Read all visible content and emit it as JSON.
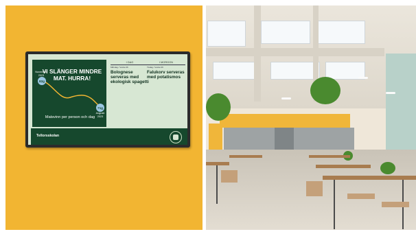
{
  "tv_screen": {
    "headline": "VI SLÄNGER MINDRE MAT. HURRA!",
    "start_month": "November",
    "start_year": "2023",
    "start_value": "82g",
    "end_value": "71g",
    "end_month": "Augusti",
    "end_year": "2023",
    "caption": "Matsvinn per person och dag",
    "today": {
      "header": "I DAG",
      "subheader": "Måndag / Vecka 36",
      "meal": "Bolognese serveras med ekologisk spagetti"
    },
    "tomorrow": {
      "header": "I MORGON",
      "subheader": "Tisdag / Vecka 36",
      "meal": "Falukorv serveras med potatismos"
    },
    "school_name": "Tellorsskolan"
  },
  "colors": {
    "wall": "#f2b532",
    "screen_bg": "#d7e7d3",
    "panel_green": "#16482d",
    "curve": "#f2b532",
    "marker": "#9cc7e3"
  },
  "icons": {
    "logo": "school-crest-icon"
  }
}
